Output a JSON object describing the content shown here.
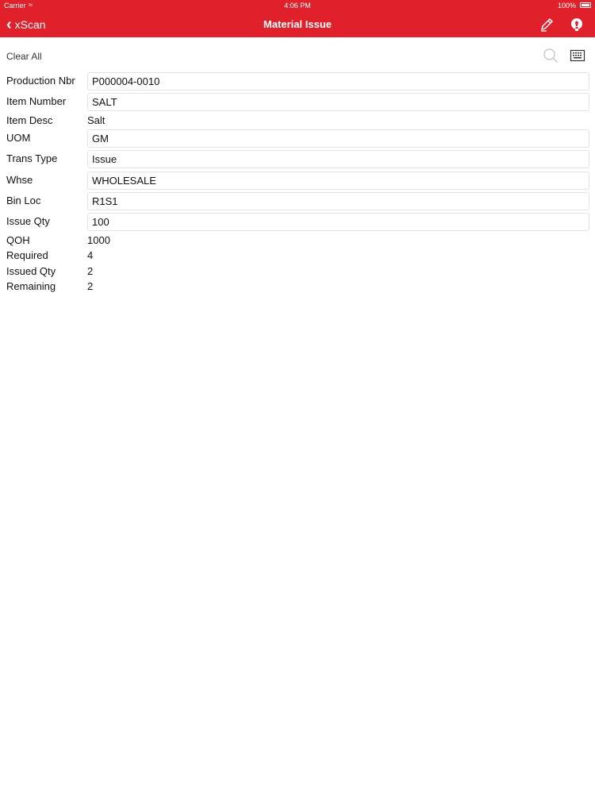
{
  "status_bar": {
    "carrier": "Carrier",
    "time": "4:06 PM",
    "battery": "100%"
  },
  "nav": {
    "back_label": "xScan",
    "title": "Material Issue"
  },
  "toolbar": {
    "clear_all": "Clear All"
  },
  "fields": {
    "production_nbr": {
      "label": "Production Nbr",
      "value": "P000004-0010"
    },
    "item_number": {
      "label": "Item Number",
      "value": "SALT"
    },
    "item_desc": {
      "label": "Item Desc",
      "value": "Salt"
    },
    "uom": {
      "label": "UOM",
      "value": "GM"
    },
    "trans_type": {
      "label": "Trans Type",
      "value": "Issue"
    },
    "whse": {
      "label": "Whse",
      "value": "WHOLESALE"
    },
    "bin_loc": {
      "label": "Bin Loc",
      "value": "R1S1"
    },
    "issue_qty": {
      "label": "Issue Qty",
      "value": "100"
    },
    "qoh": {
      "label": "QOH",
      "value": "1000"
    },
    "required": {
      "label": "Required",
      "value": "4"
    },
    "issued_qty": {
      "label": "Issued Qty",
      "value": "2"
    },
    "remaining": {
      "label": "Remaining",
      "value": "2"
    }
  },
  "colors": {
    "accent": "#e0202a"
  },
  "icons": [
    "wifi-icon",
    "battery-icon",
    "back-chevron-icon",
    "pencil-icon",
    "lightbulb-icon",
    "search-icon",
    "keyboard-icon"
  ]
}
